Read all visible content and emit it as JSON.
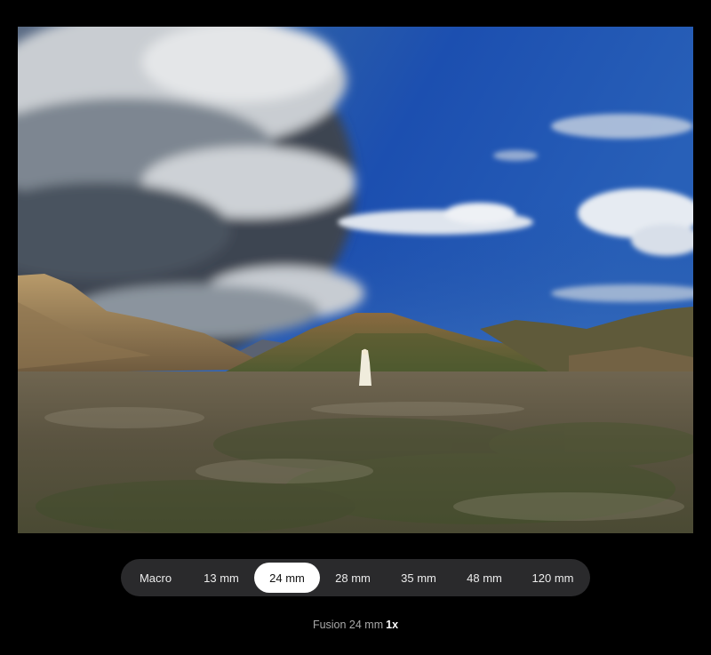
{
  "photo": {
    "alt": "Photo preview"
  },
  "lens_selector": {
    "options": [
      {
        "label": "Macro"
      },
      {
        "label": "13 mm"
      },
      {
        "label": "24 mm"
      },
      {
        "label": "28 mm"
      },
      {
        "label": "35 mm"
      },
      {
        "label": "48 mm"
      },
      {
        "label": "120 mm"
      }
    ],
    "selected": "24 mm"
  },
  "caption": {
    "lens_text": "Fusion 24 mm",
    "zoom_text": "1x"
  },
  "colors": {
    "background": "#000000",
    "pill_background": "#2a2a2c",
    "selected_pill": "#ffffff"
  }
}
